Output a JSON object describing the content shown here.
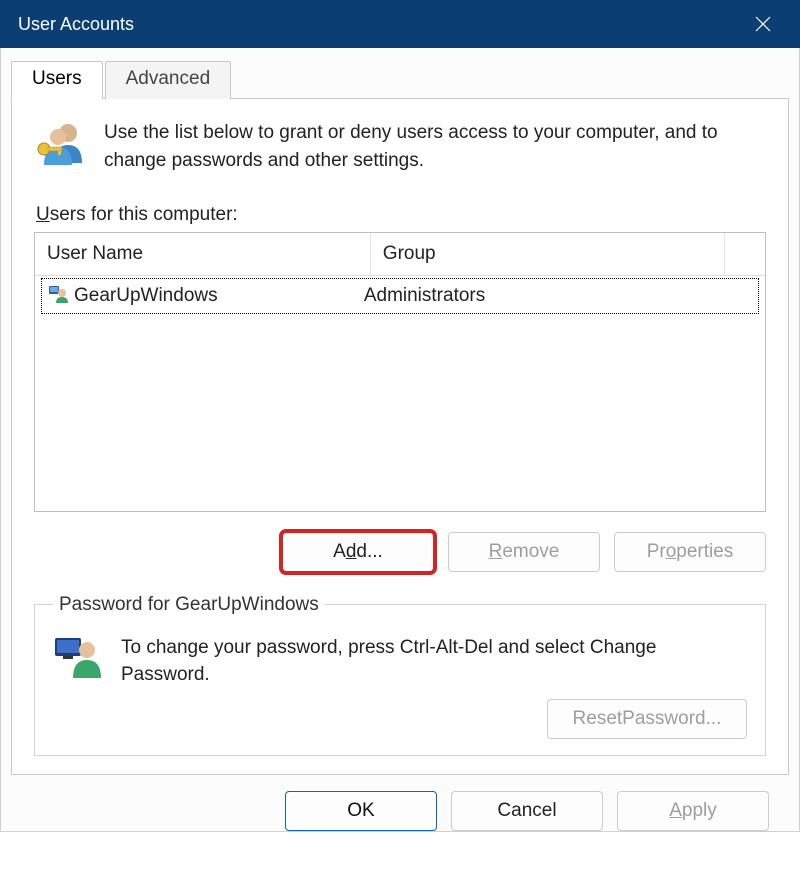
{
  "title": "User Accounts",
  "tabs": {
    "users": "Users",
    "advanced": "Advanced"
  },
  "intro_text": "Use the list below to grant or deny users access to your computer, and to change passwords and other settings.",
  "users_label_pre": "U",
  "users_label_rest": "sers for this computer:",
  "columns": {
    "name": "User Name",
    "group": "Group"
  },
  "rows": [
    {
      "name": "GearUpWindows",
      "group": "Administrators"
    }
  ],
  "buttons": {
    "add_pre": "A",
    "add_ul": "d",
    "add_post": "d...",
    "remove_ul": "R",
    "remove_post": "emove",
    "properties_pre": "Pr",
    "properties_ul": "o",
    "properties_post": "perties"
  },
  "password_group": {
    "legend": "Password for GearUpWindows",
    "text": "To change your password, press Ctrl-Alt-Del and select Change Password.",
    "reset_pre": "Reset ",
    "reset_ul": "P",
    "reset_post": "assword..."
  },
  "footer": {
    "ok": "OK",
    "cancel": "Cancel",
    "apply_ul": "A",
    "apply_post": "pply"
  }
}
